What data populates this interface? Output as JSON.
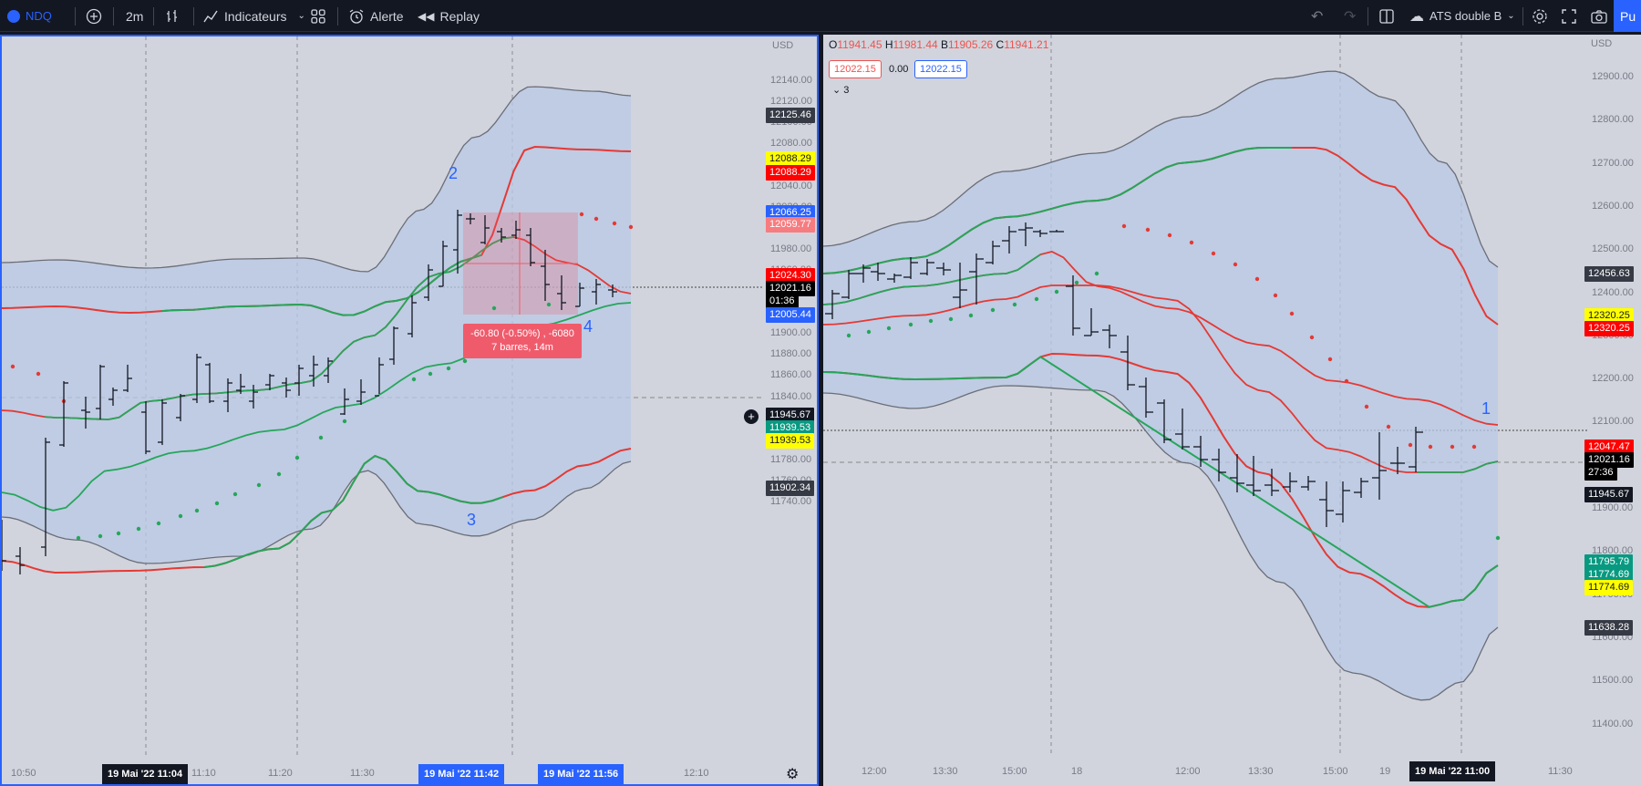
{
  "toolbar": {
    "symbol": "NDQ",
    "interval": "2m",
    "indicators_label": "Indicateurs",
    "alert_label": "Alerte",
    "replay_label": "Replay",
    "layout_name": "ATS double B",
    "publish_label": "Pu"
  },
  "left_pane": {
    "currency": "USD",
    "price_ticks": [
      "12140.00",
      "12120.00",
      "12100.00",
      "12080.00",
      "12060.00",
      "12040.00",
      "12020.00",
      "12000.00",
      "11980.00",
      "11960.00",
      "11940.00",
      "11920.00",
      "11900.00",
      "11880.00",
      "11860.00",
      "11840.00",
      "11820.00",
      "11800.00",
      "11780.00",
      "11760.00",
      "11740.00"
    ],
    "time_ticks": [
      "10:50",
      "11:10",
      "11:20",
      "11:30",
      "12:10"
    ],
    "time_badges": [
      "19 Mai '22  11:04",
      "19 Mai '22  11:42",
      "19 Mai '22  11:56"
    ],
    "price_labels": [
      {
        "text": "12125.46",
        "bg": "#363a45",
        "fg": "#ffffff"
      },
      {
        "text": "12088.29",
        "bg": "#ffff00",
        "fg": "#131722"
      },
      {
        "text": "12088.29",
        "bg": "#ff0000",
        "fg": "#ffffff"
      },
      {
        "text": "12066.25",
        "bg": "#2962ff",
        "fg": "#ffffff"
      },
      {
        "text": "12059.77",
        "bg": "#f77c80",
        "fg": "#ffffff"
      },
      {
        "text": "12024.30",
        "bg": "#ff0000",
        "fg": "#ffffff"
      },
      {
        "text": "12021.16",
        "bg": "#000000",
        "fg": "#ffffff"
      },
      {
        "text": "01:36",
        "bg": "#000000",
        "fg": "#ffffff"
      },
      {
        "text": "12005.44",
        "bg": "#2962ff",
        "fg": "#ffffff"
      },
      {
        "text": "11945.67",
        "bg": "#131722",
        "fg": "#ffffff"
      },
      {
        "text": "11939.53",
        "bg": "#089981",
        "fg": "#ffffff"
      },
      {
        "text": "11939.53",
        "bg": "#ffff00",
        "fg": "#131722"
      },
      {
        "text": "11902.34",
        "bg": "#363a45",
        "fg": "#ffffff"
      }
    ],
    "annotations": [
      "2",
      "3",
      "4"
    ],
    "measure": {
      "line1": "-60.80 (-0.50%) , -6080",
      "line2": "7 barres, 14m"
    }
  },
  "right_pane": {
    "currency": "USD",
    "ohlc": {
      "o": "11941.45",
      "h": "11981.44",
      "b": "11905.26",
      "c": "11941.21"
    },
    "inputs": {
      "a": "12022.15",
      "change": "0.00",
      "b": "12022.15",
      "collapsed_count": "3"
    },
    "price_ticks": [
      "12900.00",
      "12800.00",
      "12700.00",
      "12600.00",
      "12500.00",
      "12400.00",
      "12300.00",
      "12200.00",
      "12100.00",
      "12000.00",
      "11900.00",
      "11800.00",
      "11700.00",
      "11600.00",
      "11500.00",
      "11400.00"
    ],
    "time_ticks": [
      "12:00",
      "13:30",
      "15:00",
      "18",
      "12:00",
      "13:30",
      "15:00",
      "19",
      "11:30"
    ],
    "time_badge": "19 Mai '22  11:00",
    "price_labels": [
      {
        "text": "12456.63",
        "bg": "#363a45",
        "fg": "#ffffff"
      },
      {
        "text": "12320.25",
        "bg": "#ffff00",
        "fg": "#131722"
      },
      {
        "text": "12320.25",
        "bg": "#ff0000",
        "fg": "#ffffff"
      },
      {
        "text": "12047.47",
        "bg": "#ff0000",
        "fg": "#ffffff"
      },
      {
        "text": "12021.16",
        "bg": "#000000",
        "fg": "#ffffff"
      },
      {
        "text": "27:36",
        "bg": "#000000",
        "fg": "#ffffff"
      },
      {
        "text": "11945.67",
        "bg": "#131722",
        "fg": "#ffffff"
      },
      {
        "text": "11795.79",
        "bg": "#089981",
        "fg": "#ffffff"
      },
      {
        "text": "11774.69",
        "bg": "#089981",
        "fg": "#ffffff"
      },
      {
        "text": "11774.69",
        "bg": "#ffff00",
        "fg": "#131722"
      },
      {
        "text": "11638.28",
        "bg": "#363a45",
        "fg": "#ffffff"
      }
    ],
    "annotations": [
      "1"
    ]
  },
  "colors": {
    "green": "#26a65b",
    "red": "#e53935",
    "band": "#b8c9e6",
    "grey": "#6b6e78"
  }
}
